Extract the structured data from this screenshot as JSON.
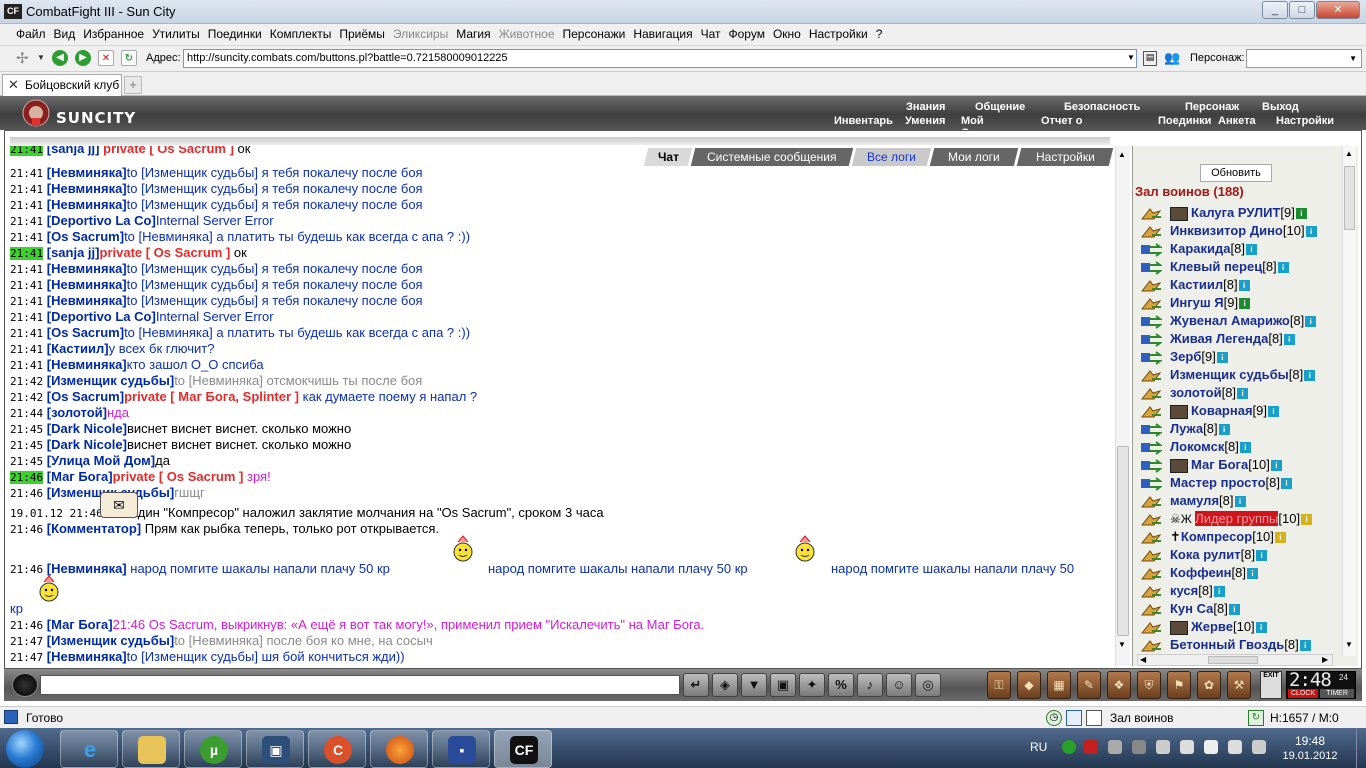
{
  "window": {
    "title": "CombatFight III - Sun City",
    "app_icon": "CF",
    "min": "_",
    "max": "□",
    "close": "✕"
  },
  "menu": {
    "items": [
      {
        "label": "Файл",
        "disabled": false
      },
      {
        "label": "Вид",
        "disabled": false
      },
      {
        "label": "Избранное",
        "disabled": false
      },
      {
        "label": "Утилиты",
        "disabled": false
      },
      {
        "label": "Поединки",
        "disabled": false
      },
      {
        "label": "Комплекты",
        "disabled": false
      },
      {
        "label": "Приёмы",
        "disabled": false
      },
      {
        "label": "Эликсиры",
        "disabled": true
      },
      {
        "label": "Магия",
        "disabled": false
      },
      {
        "label": "Животное",
        "disabled": true
      },
      {
        "label": "Персонажи",
        "disabled": false
      },
      {
        "label": "Навигация",
        "disabled": false
      },
      {
        "label": "Чат",
        "disabled": false
      },
      {
        "label": "Форум",
        "disabled": false
      },
      {
        "label": "Окно",
        "disabled": false
      },
      {
        "label": "Настройки",
        "disabled": false
      },
      {
        "label": "?",
        "disabled": false
      }
    ]
  },
  "address": {
    "label": "Адрес:",
    "url": "http://suncity.combats.com/buttons.pl?battle=0.721580009012225",
    "persona_label": "Персонаж:"
  },
  "tabs": {
    "main": "Бойцовский клуб",
    "new": "+"
  },
  "game": {
    "logo": "SUNCITY",
    "top_menu": [
      "Знания",
      "Общение",
      "Безопасность",
      "Персонаж",
      "Выход"
    ],
    "sub_menu": [
      "Инвентарь",
      "Умения",
      "Мой Скролл",
      "Отчет о переводах",
      "Поединки",
      "Анкета",
      "Настройки"
    ]
  },
  "chat_tabs": [
    "Чат",
    "Системные сообщения",
    "Все логи",
    "Мои логи",
    "Настройки"
  ],
  "chat_partial_top": {
    "time": "21:41",
    "nick": "sanja jj",
    "priv": "private [ Os Sacrum ]",
    "msg": "ок"
  },
  "chat": [
    {
      "time": "21:41",
      "nick": "Невминяка",
      "to": "to [Изменщик судьбы]",
      "msg": "я тебя покалечу после боя",
      "style": "blue"
    },
    {
      "time": "21:41",
      "nick": "Невминяка",
      "to": "to [Изменщик судьбы]",
      "msg": "я тебя покалечу после боя",
      "style": "blue"
    },
    {
      "time": "21:41",
      "nick": "Невминяка",
      "to": "to [Изменщик судьбы]",
      "msg": "я тебя покалечу после боя",
      "style": "blue"
    },
    {
      "time": "21:41",
      "nick": "Deportivo La Co",
      "to": "",
      "msg": "Internal Server Error",
      "style": "blue"
    },
    {
      "time": "21:41",
      "nick": "Os Sacrum",
      "to": "to [Невминяка]",
      "msg": "а платить ты будешь как всегда с апа ? :))",
      "style": "blue"
    },
    {
      "time": "21:41",
      "nick": "sanja jj",
      "to": "",
      "priv": "private [ Os Sacrum ]",
      "msg": "ок",
      "style": "blk",
      "hl": true
    },
    {
      "time": "21:41",
      "nick": "Невминяка",
      "to": "to [Изменщик судьбы]",
      "msg": "я тебя покалечу после боя",
      "style": "blue"
    },
    {
      "time": "21:41",
      "nick": "Невминяка",
      "to": "to [Изменщик судьбы]",
      "msg": "я тебя покалечу после боя",
      "style": "blue"
    },
    {
      "time": "21:41",
      "nick": "Невминяка",
      "to": "to [Изменщик судьбы]",
      "msg": "я тебя покалечу после боя",
      "style": "blue"
    },
    {
      "time": "21:41",
      "nick": "Deportivo La Co",
      "to": "",
      "msg": "Internal Server Error",
      "style": "blue"
    },
    {
      "time": "21:41",
      "nick": "Os Sacrum",
      "to": "to [Невминяка]",
      "msg": "а платить ты будешь как всегда с апа ? :))",
      "style": "blue"
    },
    {
      "time": "21:41",
      "nick": "Кастиил",
      "to": "",
      "msg": "у всех бк глючит?",
      "style": "blue"
    },
    {
      "time": "21:41",
      "nick": "Невминяка",
      "to": "",
      "msg": "кто зашол О_О спсиба",
      "style": "blue"
    },
    {
      "time": "21:42",
      "nick": "Изменщик судьбы",
      "to": "to [Невминяка]",
      "msg": "отсмокчишь ты после боя",
      "style": "gray"
    },
    {
      "time": "21:42",
      "nick": "Os Sacrum",
      "to": "",
      "priv": "private [ Маг Бога, Splinter ]",
      "msg": "как думаете поему я напал ?",
      "style": "blue"
    },
    {
      "time": "21:44",
      "nick": "золотой",
      "to": "",
      "msg": "нда",
      "style": "mag"
    },
    {
      "time": "21:45",
      "nick": "Dark Nicole",
      "to": "",
      "msg": "виснет виснет виснет. сколько можно",
      "style": "blk"
    },
    {
      "time": "21:45",
      "nick": "Dark Nicole",
      "to": "",
      "msg": "виснет виснет виснет. сколько можно",
      "style": "blk"
    },
    {
      "time": "21:45",
      "nick": "Улица Мой Дом",
      "to": "",
      "msg": "да",
      "style": "blk"
    },
    {
      "time": "21:46",
      "nick": "Маг Бога",
      "to": "",
      "priv": "private [ Os Sacrum ]",
      "msg": "зря!",
      "style": "mag",
      "hl": true
    },
    {
      "time": "21:46",
      "nick": "Изменщик судьбы",
      "to": "",
      "msg": "гшщг",
      "style": "gray"
    }
  ],
  "chat_system": {
    "time": "19.01.12 21:46",
    "msg": "Паладин \"Компресор\" наложил заклятие молчания на \"Os Sacrum\", сроком 3 часа"
  },
  "chat_comment": {
    "time": "21:46",
    "nick": "Комментатор",
    "msg": "Прям как рыбка теперь, только рот открывается."
  },
  "chat_spam": {
    "time": "21:46",
    "nick": "Невминяка",
    "msg1": "народ помгите шакалы напали плачу 50 кр",
    "msg2": "народ помгите шакалы напали плачу 50 кр",
    "msg3": "народ помгите шакалы напали плачу 50",
    "tail": "кр"
  },
  "chat_tail": [
    {
      "time": "21:46",
      "nick": "Маг Бога",
      "to": "",
      "msg": "21:46 Os Sacrum, выкрикнув: «А ещё я вот так могу!», применил прием \"Искалечить\" на Маг Бога.",
      "style": "mag"
    },
    {
      "time": "21:47",
      "nick": "Изменщик судьбы",
      "to": "to [Невминяка]",
      "msg": "после боя ко мне, на сосыч",
      "style": "gray"
    },
    {
      "time": "21:47",
      "nick": "Невминяка",
      "to": "to [Изменщик судьбы]",
      "msg": "шя бой кончиться жди))",
      "style": "blue"
    }
  ],
  "room": {
    "refresh": "Обновить",
    "title": "Зал воинов (188)"
  },
  "players": [
    {
      "name": "Калуга РУЛИТ",
      "level": "[9]",
      "icon": "bag",
      "avatar": true,
      "info": "green"
    },
    {
      "name": "Инквизитор Дино",
      "level": "[10]",
      "icon": "bag",
      "info": "blue"
    },
    {
      "name": "Каракида",
      "level": "[8]",
      "icon": "swap",
      "info": "blue"
    },
    {
      "name": "Клевый перец",
      "level": "[8]",
      "icon": "swap",
      "info": "blue"
    },
    {
      "name": "Кастиил",
      "level": "[8]",
      "icon": "bag",
      "info": "blue"
    },
    {
      "name": "Ингуш Я",
      "level": "[9]",
      "icon": "bag",
      "info": "green"
    },
    {
      "name": "Жувенал Амарижо",
      "level": "[8]",
      "icon": "swap",
      "info": "blue"
    },
    {
      "name": "Живая Легенда",
      "level": "[8]",
      "icon": "swap",
      "info": "blue"
    },
    {
      "name": "Зерб",
      "level": "[9]",
      "icon": "swap",
      "info": "blue"
    },
    {
      "name": "Изменщик судьбы",
      "level": "[8]",
      "icon": "bag",
      "info": "blue"
    },
    {
      "name": "золотой",
      "level": "[8]",
      "icon": "bag",
      "info": "blue"
    },
    {
      "name": "Коварная",
      "level": "[9]",
      "icon": "bag",
      "avatar": true,
      "info": "blue"
    },
    {
      "name": "Лужа",
      "level": "[8]",
      "icon": "swap",
      "info": "blue"
    },
    {
      "name": "Локомск",
      "level": "[8]",
      "icon": "swap",
      "info": "blue"
    },
    {
      "name": "Маг Бога",
      "level": "[10]",
      "icon": "swap",
      "avatar": true,
      "info": "blue"
    },
    {
      "name": "Мастер просто",
      "level": "[8]",
      "icon": "swap",
      "info": "blue"
    },
    {
      "name": "мамуля",
      "level": "[8]",
      "icon": "bag",
      "info": "blue"
    },
    {
      "name": "Лидер группы",
      "level": "[10]",
      "icon": "bag",
      "leader": true,
      "info": "yellow"
    },
    {
      "name": "Компресор",
      "level": "[10]",
      "icon": "bag",
      "cross": true,
      "info": "yellow"
    },
    {
      "name": "Кока рулит",
      "level": "[8]",
      "icon": "bag",
      "info": "blue"
    },
    {
      "name": "Коффеин",
      "level": "[8]",
      "icon": "bag",
      "info": "blue"
    },
    {
      "name": "куся",
      "level": "[8]",
      "icon": "bag",
      "info": "blue"
    },
    {
      "name": "Кун Са",
      "level": "[8]",
      "icon": "bag",
      "info": "blue"
    },
    {
      "name": "Жерве",
      "level": "[10]",
      "icon": "bag",
      "avatar": true,
      "info": "blue"
    },
    {
      "name": "Бетонный Гвоздь",
      "level": "[8]",
      "icon": "bag",
      "info": "blue"
    }
  ],
  "clock": {
    "time": "2:48",
    "sec": "24",
    "lbl1": "CLOCK",
    "lbl2": "TIMER",
    "exit": "EXIT"
  },
  "status": {
    "text": "Готово",
    "room": "Зал воинов",
    "hp": "H:1657 / M:0"
  },
  "taskbar": {
    "lang": "RU",
    "time": "19:48",
    "date": "19.01.2012"
  },
  "colors": {
    "nick": "#002aa3",
    "private": "#e22b2b",
    "magenta": "#d11bd9",
    "highlight": "#3cd22c",
    "hall": "#a01818"
  }
}
